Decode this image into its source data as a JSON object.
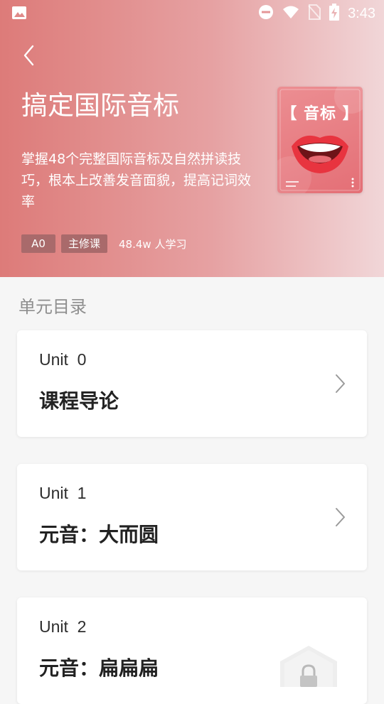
{
  "status_bar": {
    "time": "3:43",
    "left_icon": "image-icon",
    "right_icons": [
      "do-not-disturb-icon",
      "wifi-icon",
      "no-sim-icon",
      "battery-charging-icon"
    ]
  },
  "header": {
    "back_icon": "chevron-left-icon",
    "title": "搞定国际音标",
    "description": "掌握48个完整国际音标及自然拼读技巧，根本上改善发音面貌，提高记词效率",
    "tags": [
      "A0",
      "主修课"
    ],
    "learners": "48.4w 人学习",
    "cover": {
      "title": "【 音标 】",
      "icon": "open-mouth-icon"
    }
  },
  "catalog": {
    "section_title": "单元目录",
    "units": [
      {
        "label": "Unit  0",
        "title": "课程导论",
        "locked": false,
        "action_icon": "chevron-right-icon"
      },
      {
        "label": "Unit  1",
        "title": "元音：大而圆",
        "locked": false,
        "action_icon": "chevron-right-icon"
      },
      {
        "label": "Unit  2",
        "title": "元音：扁扁扁",
        "locked": true,
        "action_icon": "lock-icon"
      }
    ]
  },
  "colors": {
    "hero_start": "#dd7b79",
    "hero_end": "#f1d6d8",
    "tag_bg": "#a96a6b",
    "page_bg": "#f6f6f6",
    "card_bg": "#ffffff"
  }
}
